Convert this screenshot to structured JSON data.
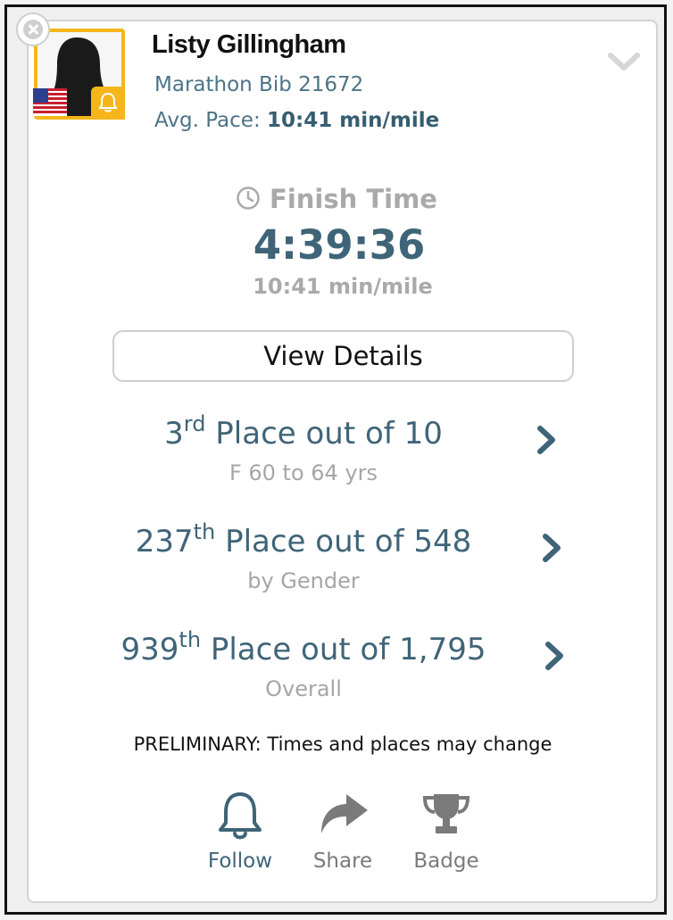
{
  "profile": {
    "name": "Listy Gillingham",
    "bib": "Marathon Bib 21672",
    "pace_label": "Avg. Pace: ",
    "pace_value": "10:41 min/mile"
  },
  "finish": {
    "label": "Finish Time",
    "time": "4:39:36",
    "pace": "10:41 min/mile"
  },
  "view_details_label": "View Details",
  "places": [
    {
      "rank": "3",
      "suffix": "rd",
      "text": " Place out of 10",
      "subtitle": "F 60 to 64 yrs"
    },
    {
      "rank": "237",
      "suffix": "th",
      "text": " Place out of 548",
      "subtitle": "by Gender"
    },
    {
      "rank": "939",
      "suffix": "th",
      "text": " Place out of 1,795",
      "subtitle": "Overall"
    }
  ],
  "notice": "PRELIMINARY: Times and places may change",
  "actions": {
    "follow": "Follow",
    "share": "Share",
    "badge": "Badge"
  },
  "colors": {
    "accent": "#f5b51b",
    "primary_text": "#3f6478",
    "muted_text": "#a9a9a9",
    "follow_active": "#3f6478",
    "inactive_icon": "#7a7a7a"
  },
  "icons": {
    "close": "close-icon",
    "flag": "us-flag-icon",
    "bell_badge": "bell-icon",
    "collapse": "chevron-down-icon",
    "clock": "clock-icon",
    "arrow": "chevron-right-icon",
    "follow": "bell-icon",
    "share": "share-arrow-icon",
    "badge": "trophy-icon"
  }
}
